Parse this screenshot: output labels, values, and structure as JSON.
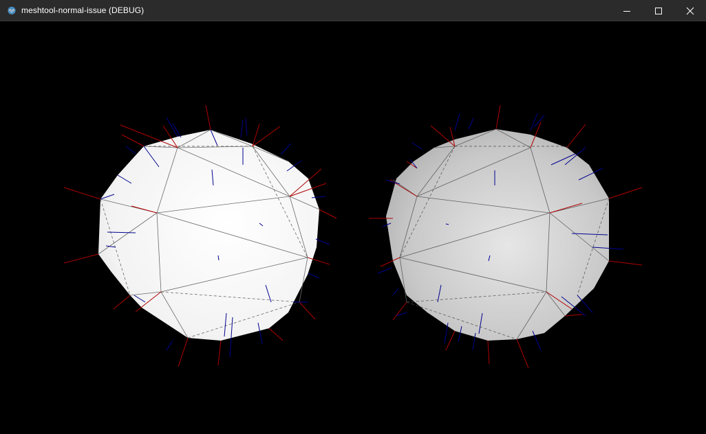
{
  "window": {
    "title": "meshtool-normal-issue (DEBUG)",
    "icon": "godot-engine-icon",
    "controls": [
      "minimize-icon",
      "maximize-icon",
      "close-icon"
    ]
  },
  "viewport": {
    "background": "#000000",
    "normal_colors": {
      "vertex": "#b00000",
      "face": "#000090"
    },
    "meshes": [
      {
        "name": "left-sphere",
        "shading": "flat"
      },
      {
        "name": "right-sphere",
        "shading": "smooth"
      }
    ]
  }
}
